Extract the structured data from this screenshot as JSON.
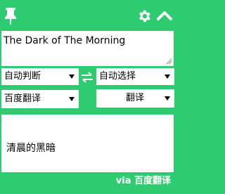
{
  "header": {
    "pin_icon": "pin-icon",
    "settings_icon": "gear-icon",
    "collapse_icon": "chevron-up-icon"
  },
  "input": {
    "text": "The Dark of The Morning"
  },
  "languages": {
    "source": "自动判断",
    "swap_icon": "swap-icon",
    "target": "自动选择"
  },
  "engine": {
    "selected": "百度翻译",
    "translate_button": "翻译"
  },
  "result": {
    "text": "清晨的黑暗"
  },
  "footer": {
    "credit": "via 百度翻译"
  },
  "colors": {
    "accent": "#2ecc71",
    "panel": "#ffffff",
    "text": "#000000"
  }
}
